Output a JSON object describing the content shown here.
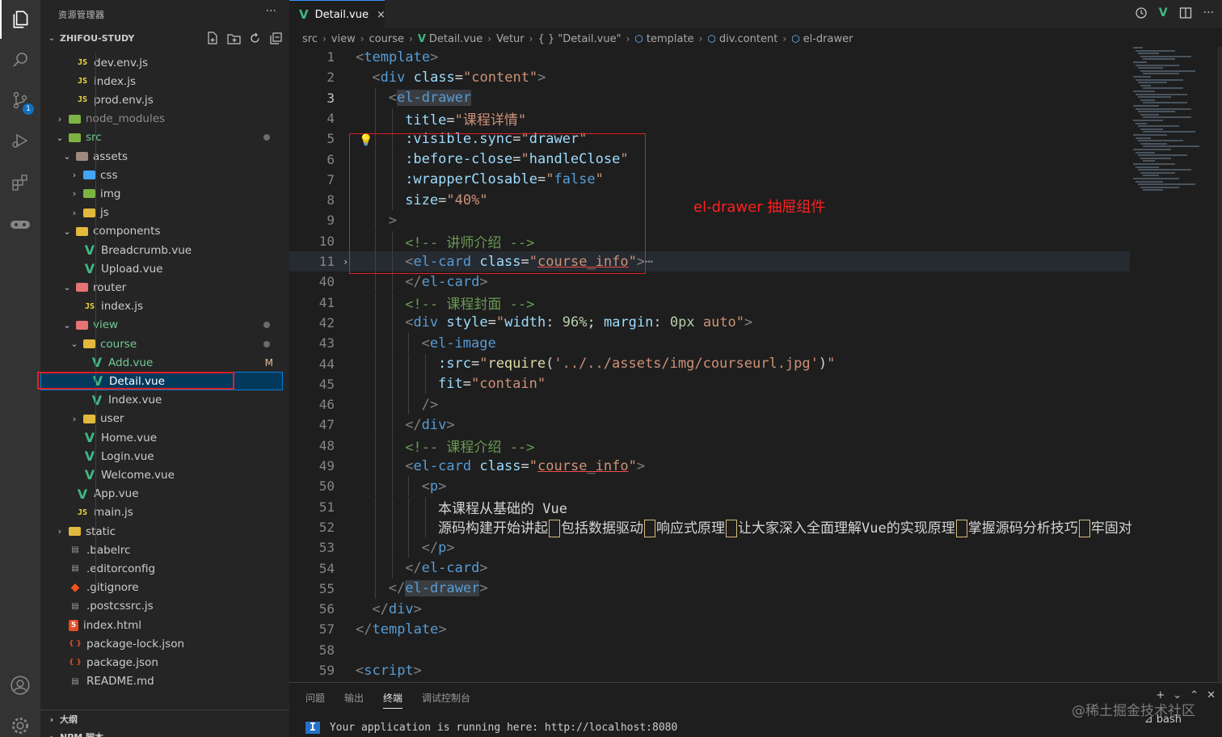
{
  "activity": {
    "icons": [
      "explorer-icon",
      "search-icon",
      "source-control-icon",
      "run-debug-icon",
      "extensions-icon",
      "remote-icon",
      "account-icon",
      "settings-icon"
    ],
    "scm_badge": "1"
  },
  "sidebar": {
    "title": "资源管理器",
    "more": "···",
    "project": "ZHIFOU-STUDY",
    "bottom": {
      "outline": "大纲",
      "npm": "NPM 脚本"
    }
  },
  "tree": [
    {
      "label": "dev.env.js",
      "icon": "js",
      "depth": 2
    },
    {
      "label": "index.js",
      "icon": "js",
      "depth": 2
    },
    {
      "label": "prod.env.js",
      "icon": "js",
      "depth": 2
    },
    {
      "label": "node_modules",
      "icon": "folder-green",
      "depth": 1,
      "chevron": "›",
      "dim": true
    },
    {
      "label": "src",
      "icon": "folder-green",
      "depth": 1,
      "chevron": "⌄",
      "green": true,
      "dot": true
    },
    {
      "label": "assets",
      "icon": "folder-brown",
      "depth": 2,
      "chevron": "⌄"
    },
    {
      "label": "css",
      "icon": "folder-blue",
      "depth": 3,
      "chevron": "›"
    },
    {
      "label": "img",
      "icon": "folder-green",
      "depth": 3,
      "chevron": "›"
    },
    {
      "label": "js",
      "icon": "folder-yellow",
      "depth": 3,
      "chevron": "›"
    },
    {
      "label": "components",
      "icon": "folder-yellow",
      "depth": 2,
      "chevron": "⌄"
    },
    {
      "label": "Breadcrumb.vue",
      "icon": "vue",
      "depth": 3
    },
    {
      "label": "Upload.vue",
      "icon": "vue",
      "depth": 3
    },
    {
      "label": "router",
      "icon": "folder-red",
      "depth": 2,
      "chevron": "⌄"
    },
    {
      "label": "index.js",
      "icon": "js",
      "depth": 3
    },
    {
      "label": "view",
      "icon": "folder-red",
      "depth": 2,
      "chevron": "⌄",
      "green": true,
      "dot": true
    },
    {
      "label": "course",
      "icon": "folder-yellow",
      "depth": 3,
      "chevron": "⌄",
      "green": true,
      "dot": true
    },
    {
      "label": "Add.vue",
      "icon": "vue",
      "depth": 4,
      "green": true,
      "mark": "M"
    },
    {
      "label": "Detail.vue",
      "icon": "vue",
      "depth": 4,
      "selected": true
    },
    {
      "label": "Index.vue",
      "icon": "vue",
      "depth": 4
    },
    {
      "label": "user",
      "icon": "folder-yellow",
      "depth": 3,
      "chevron": "›"
    },
    {
      "label": "Home.vue",
      "icon": "vue",
      "depth": 3
    },
    {
      "label": "Login.vue",
      "icon": "vue",
      "depth": 3
    },
    {
      "label": "Welcome.vue",
      "icon": "vue",
      "depth": 3
    },
    {
      "label": "App.vue",
      "icon": "vue",
      "depth": 2
    },
    {
      "label": "main.js",
      "icon": "js",
      "depth": 2
    },
    {
      "label": "static",
      "icon": "folder-yellow",
      "depth": 1,
      "chevron": "›"
    },
    {
      "label": ".babelrc",
      "icon": "file",
      "depth": 1
    },
    {
      "label": ".editorconfig",
      "icon": "file",
      "depth": 1
    },
    {
      "label": ".gitignore",
      "icon": "git",
      "depth": 1
    },
    {
      "label": ".postcssrc.js",
      "icon": "file",
      "depth": 1
    },
    {
      "label": "index.html",
      "icon": "html",
      "depth": 1
    },
    {
      "label": "package-lock.json",
      "icon": "json",
      "depth": 1
    },
    {
      "label": "package.json",
      "icon": "json",
      "depth": 1
    },
    {
      "label": "README.md",
      "icon": "file",
      "depth": 1
    }
  ],
  "editor": {
    "tab_title": "Detail.vue",
    "tab_close": "×",
    "breadcrumb": [
      "src",
      "view",
      "course",
      "Detail.vue",
      "Vetur",
      "{ } \"Detail.vue\"",
      "template",
      "div.content",
      "el-drawer"
    ],
    "annotation": "el-drawer 抽屉组件",
    "lines": [
      {
        "n": "1",
        "indent": 0,
        "parts": [
          [
            "tg",
            "<"
          ],
          [
            "tn",
            "template"
          ],
          [
            "tg",
            ">"
          ]
        ]
      },
      {
        "n": "2",
        "indent": 1,
        "parts": [
          [
            "tg",
            "<"
          ],
          [
            "tn",
            "div"
          ],
          [
            "pl",
            " "
          ],
          [
            "an",
            "class"
          ],
          [
            "pl",
            "="
          ],
          [
            "sv",
            "\"content\""
          ],
          [
            "tg",
            ">"
          ]
        ]
      },
      {
        "n": "3",
        "indent": 2,
        "cur": true,
        "parts": [
          [
            "tg",
            "<"
          ],
          [
            "tn tagsel",
            "el-drawer"
          ]
        ]
      },
      {
        "n": "4",
        "indent": 3,
        "parts": [
          [
            "an",
            "title"
          ],
          [
            "pl",
            "="
          ],
          [
            "sv",
            "\"课程详情\""
          ]
        ]
      },
      {
        "n": "5",
        "indent": 3,
        "parts": [
          [
            "an",
            ":visible.sync"
          ],
          [
            "pl",
            "="
          ],
          [
            "sv",
            "\""
          ],
          [
            "an",
            "drawer"
          ],
          [
            "sv",
            "\""
          ]
        ]
      },
      {
        "n": "6",
        "indent": 3,
        "parts": [
          [
            "an",
            ":before-close"
          ],
          [
            "pl",
            "="
          ],
          [
            "sv",
            "\""
          ],
          [
            "an",
            "handleClose"
          ],
          [
            "sv",
            "\""
          ]
        ]
      },
      {
        "n": "7",
        "indent": 3,
        "parts": [
          [
            "an",
            ":wrapperClosable"
          ],
          [
            "pl",
            "="
          ],
          [
            "sv",
            "\""
          ],
          [
            "bl",
            "false"
          ],
          [
            "sv",
            "\""
          ]
        ]
      },
      {
        "n": "8",
        "indent": 3,
        "parts": [
          [
            "an",
            "size"
          ],
          [
            "pl",
            "="
          ],
          [
            "sv",
            "\"40%\""
          ]
        ]
      },
      {
        "n": "9",
        "indent": 2,
        "parts": [
          [
            "tg",
            ">"
          ]
        ]
      },
      {
        "n": "10",
        "indent": 3,
        "parts": [
          [
            "cm",
            "<!-- 讲师介绍 -->"
          ]
        ]
      },
      {
        "n": "11",
        "indent": 3,
        "hl": true,
        "fold": true,
        "parts": [
          [
            "tg",
            "<"
          ],
          [
            "tn",
            "el-card"
          ],
          [
            "pl",
            " "
          ],
          [
            "an",
            "class"
          ],
          [
            "pl",
            "="
          ],
          [
            "sv",
            "\""
          ],
          [
            "sv und",
            "course_info"
          ],
          [
            "sv",
            "\""
          ],
          [
            "tg",
            ">"
          ],
          [
            "tg",
            "⋯"
          ]
        ]
      },
      {
        "n": "40",
        "indent": 3,
        "parts": [
          [
            "tg",
            "</"
          ],
          [
            "tn",
            "el-card"
          ],
          [
            "tg",
            ">"
          ]
        ]
      },
      {
        "n": "41",
        "indent": 3,
        "parts": [
          [
            "cm",
            "<!-- 课程封面 -->"
          ]
        ]
      },
      {
        "n": "42",
        "indent": 3,
        "parts": [
          [
            "tg",
            "<"
          ],
          [
            "tn",
            "div"
          ],
          [
            "pl",
            " "
          ],
          [
            "an",
            "style"
          ],
          [
            "pl",
            "="
          ],
          [
            "sv",
            "\""
          ],
          [
            "an",
            "width"
          ],
          [
            "pl",
            ": "
          ],
          [
            "nm",
            "96%"
          ],
          [
            "pl",
            "; "
          ],
          [
            "an",
            "margin"
          ],
          [
            "pl",
            ": "
          ],
          [
            "nm",
            "0px"
          ],
          [
            "pl",
            " "
          ],
          [
            "sv",
            "auto"
          ],
          [
            "sv",
            "\""
          ],
          [
            "tg",
            ">"
          ]
        ]
      },
      {
        "n": "43",
        "indent": 4,
        "parts": [
          [
            "tg",
            "<"
          ],
          [
            "tn",
            "el-image"
          ]
        ]
      },
      {
        "n": "44",
        "indent": 5,
        "parts": [
          [
            "an",
            ":src"
          ],
          [
            "pl",
            "="
          ],
          [
            "sv",
            "\""
          ],
          [
            "fn",
            "require"
          ],
          [
            "pl",
            "("
          ],
          [
            "sv",
            "'../../assets/img/courseurl.jpg'"
          ],
          [
            "pl",
            ")"
          ],
          [
            "sv",
            "\""
          ]
        ]
      },
      {
        "n": "45",
        "indent": 5,
        "parts": [
          [
            "an",
            "fit"
          ],
          [
            "pl",
            "="
          ],
          [
            "sv",
            "\"contain\""
          ]
        ]
      },
      {
        "n": "46",
        "indent": 4,
        "parts": [
          [
            "tg",
            "/>"
          ]
        ]
      },
      {
        "n": "47",
        "indent": 3,
        "parts": [
          [
            "tg",
            "</"
          ],
          [
            "tn",
            "div"
          ],
          [
            "tg",
            ">"
          ]
        ]
      },
      {
        "n": "48",
        "indent": 3,
        "parts": [
          [
            "cm",
            "<!-- 课程介绍 -->"
          ]
        ]
      },
      {
        "n": "49",
        "indent": 3,
        "parts": [
          [
            "tg",
            "<"
          ],
          [
            "tn",
            "el-card"
          ],
          [
            "pl",
            " "
          ],
          [
            "an",
            "class"
          ],
          [
            "pl",
            "="
          ],
          [
            "sv",
            "\""
          ],
          [
            "sv und",
            "course_info"
          ],
          [
            "sv",
            "\""
          ],
          [
            "tg",
            ">"
          ]
        ]
      },
      {
        "n": "50",
        "indent": 4,
        "parts": [
          [
            "tg",
            "<"
          ],
          [
            "tn",
            "p"
          ],
          [
            "tg",
            ">"
          ]
        ]
      },
      {
        "n": "51",
        "indent": 5,
        "parts": [
          [
            "pl",
            "本课程从基础的 Vue"
          ]
        ]
      },
      {
        "n": "52",
        "indent": 5,
        "parts": [
          [
            "pl",
            "源码构建开始讲起"
          ],
          [
            "box",
            ""
          ],
          [
            "pl",
            "包括数据驱动"
          ],
          [
            "box",
            ""
          ],
          [
            "pl",
            "响应式原理"
          ],
          [
            "box",
            ""
          ],
          [
            "pl",
            "让大家深入全面理解Vue的实现原理"
          ],
          [
            "box",
            ""
          ],
          [
            "pl",
            "掌握源码分析技巧"
          ],
          [
            "box",
            ""
          ],
          [
            "pl",
            "牢固对"
          ]
        ]
      },
      {
        "n": "53",
        "indent": 4,
        "parts": [
          [
            "tg",
            "</"
          ],
          [
            "tn",
            "p"
          ],
          [
            "tg",
            ">"
          ]
        ]
      },
      {
        "n": "54",
        "indent": 3,
        "parts": [
          [
            "tg",
            "</"
          ],
          [
            "tn",
            "el-card"
          ],
          [
            "tg",
            ">"
          ]
        ]
      },
      {
        "n": "55",
        "indent": 2,
        "parts": [
          [
            "tg",
            "</"
          ],
          [
            "tn tagsel",
            "el-drawer"
          ],
          [
            "tg",
            ">"
          ]
        ]
      },
      {
        "n": "56",
        "indent": 1,
        "parts": [
          [
            "tg",
            "</"
          ],
          [
            "tn",
            "div"
          ],
          [
            "tg",
            ">"
          ]
        ]
      },
      {
        "n": "57",
        "indent": 0,
        "parts": [
          [
            "tg",
            "</"
          ],
          [
            "tn",
            "template"
          ],
          [
            "tg",
            ">"
          ]
        ]
      },
      {
        "n": "58",
        "indent": 0,
        "parts": []
      },
      {
        "n": "59",
        "indent": 0,
        "parts": [
          [
            "tg",
            "<"
          ],
          [
            "tn",
            "script"
          ],
          [
            "tg",
            ">"
          ]
        ]
      }
    ]
  },
  "panel": {
    "tabs": [
      "问题",
      "输出",
      "终端",
      "调试控制台"
    ],
    "active_tab": "终端",
    "terminal_badge": "I",
    "terminal_text": "Your application is running here: http://localhost:8080",
    "shell": "bash",
    "watermark": "@稀土掘金技术社区"
  }
}
